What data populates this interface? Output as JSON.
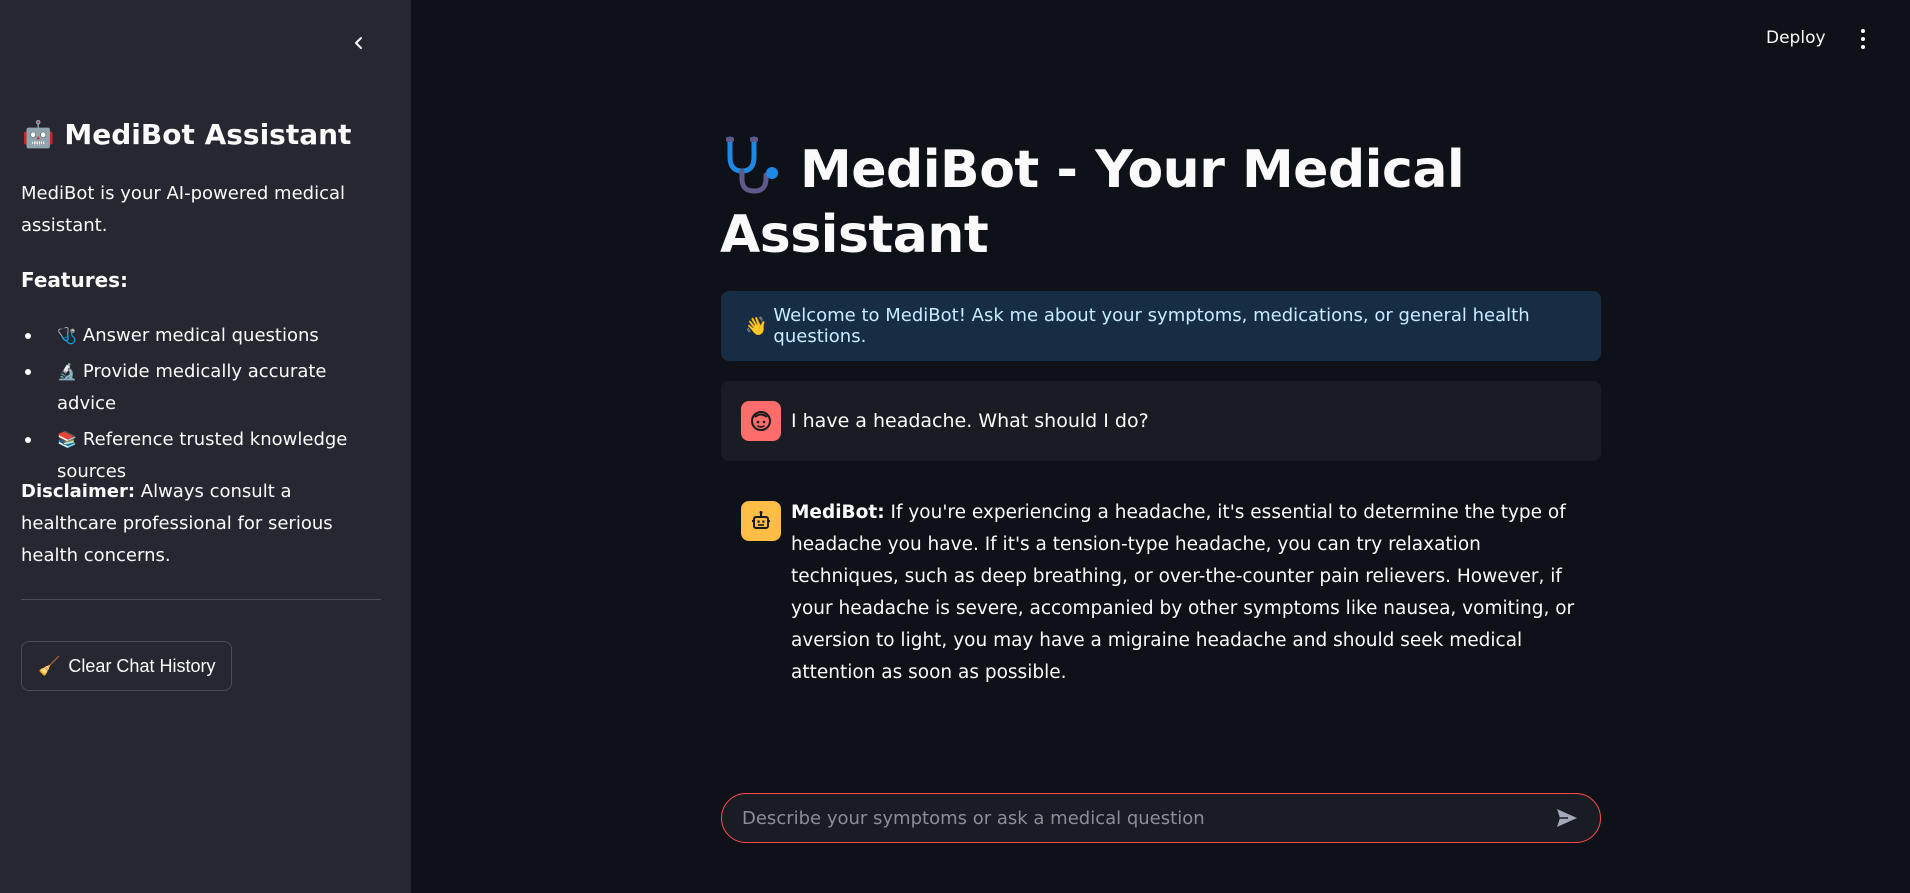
{
  "sidebar": {
    "title_emoji": "🤖",
    "title": "MediBot Assistant",
    "description": "MediBot is your AI-powered medical assistant.",
    "features_heading": "Features:",
    "features": [
      {
        "icon": "🩺",
        "label": "Answer medical questions"
      },
      {
        "icon": "🔬",
        "label": "Provide medically accurate advice"
      },
      {
        "icon": "📚",
        "label": "Reference trusted knowledge sources"
      }
    ],
    "disclaimer_label": "Disclaimer:",
    "disclaimer_text": "Always consult a healthcare professional for serious health concerns.",
    "clear_button_icon": "🧹",
    "clear_button_label": "Clear Chat History"
  },
  "header": {
    "deploy_label": "Deploy"
  },
  "main": {
    "title": "MediBot - Your Medical Assistant",
    "title_icon": "stethoscope-icon",
    "info_icon": "👋",
    "info_text": "Welcome to MediBot! Ask me about your symptoms, medications, or general health questions.",
    "messages": [
      {
        "role": "user",
        "avatar": "user-face-icon",
        "text": "I have a headache. What should I do?"
      },
      {
        "role": "assistant",
        "avatar": "robot-icon",
        "speaker": "MediBot:",
        "text": "If you're experiencing a headache, it's essential to determine the type of headache you have. If it's a tension-type headache, you can try relaxation techniques, such as deep breathing, or over-the-counter pain relievers. However, if your headache is severe, accompanied by other symptoms like nausea, vomiting, or aversion to light, you may have a migraine headache and should seek medical attention as soon as possible."
      }
    ],
    "input_placeholder": "Describe your symptoms or ask a medical question",
    "input_value": ""
  },
  "colors": {
    "background": "#0e1117",
    "sidebar": "#262730",
    "info_bg": "#172d43",
    "user_avatar": "#ff6c6c",
    "bot_avatar": "#ffbd45",
    "input_border": "#ff4b4b"
  }
}
